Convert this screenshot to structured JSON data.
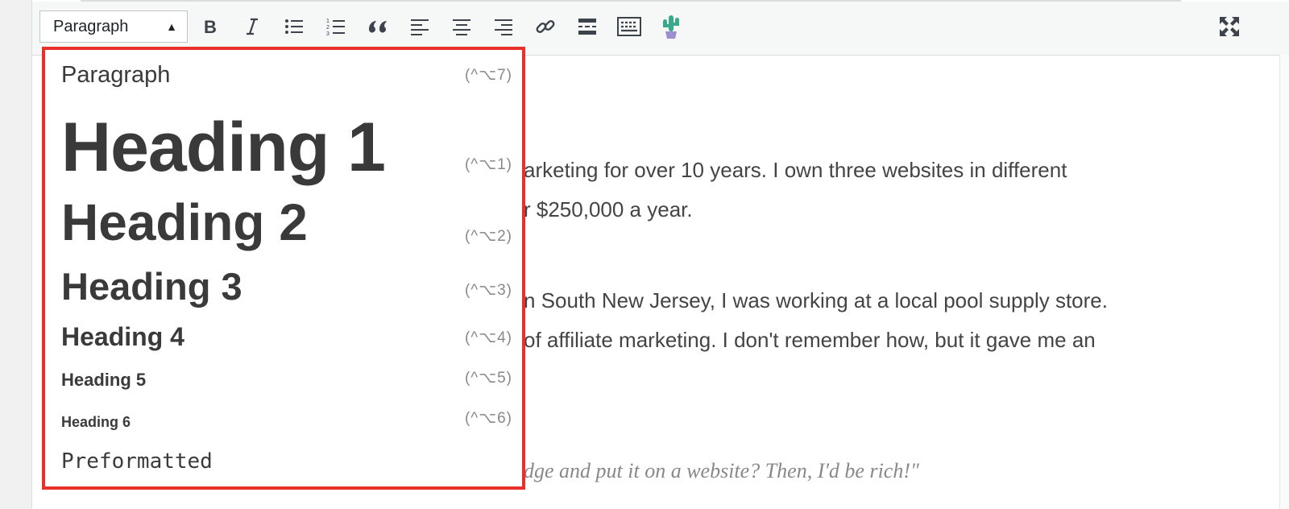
{
  "toolbar": {
    "format_select_value": "Paragraph",
    "buttons": [
      "bold",
      "italic",
      "bulleted-list",
      "numbered-list",
      "blockquote",
      "align-left",
      "align-center",
      "align-right",
      "insert-link",
      "read-more",
      "toolbar-toggle",
      "cactus-plugin",
      "fullscreen"
    ]
  },
  "dropdown": {
    "items": [
      {
        "label": "Paragraph",
        "shortcut": "(^⌥7)"
      },
      {
        "label": "Heading 1",
        "shortcut": "(^⌥1)"
      },
      {
        "label": "Heading 2",
        "shortcut": "(^⌥2)"
      },
      {
        "label": "Heading 3",
        "shortcut": "(^⌥3)"
      },
      {
        "label": "Heading 4",
        "shortcut": "(^⌥4)"
      },
      {
        "label": "Heading 5",
        "shortcut": "(^⌥5)"
      },
      {
        "label": "Heading 6",
        "shortcut": "(^⌥6)"
      },
      {
        "label": "Preformatted",
        "shortcut": ""
      }
    ]
  },
  "content": {
    "line1": "arketing for over 10 years. I own three websites in different",
    "line2": "r $250,000 a year.",
    "line3": "n South New Jersey, I was working at a local pool supply store.",
    "line4": "of affiliate marketing. I don't remember how, but it gave me an",
    "quote": "dge and put it on a website? Then, I'd be rich!\""
  },
  "colors": {
    "highlight_border": "#e8312a",
    "cactus": "#3aa88a",
    "cactus_pot": "#9b8fd0"
  }
}
